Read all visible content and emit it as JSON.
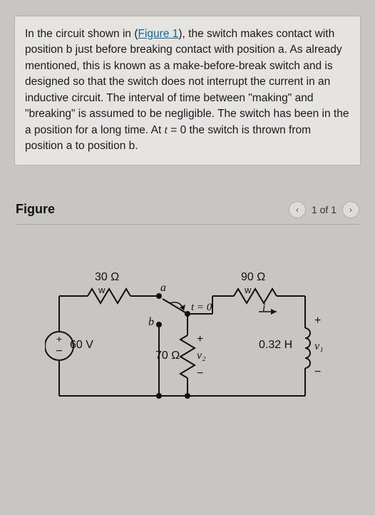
{
  "problem": {
    "text_before_link": "In the circuit shown in (",
    "link_label": "Figure 1",
    "text_after_link": "), the switch makes contact with position b just before breaking contact with position a. As already mentioned, this is known as a make-before-break switch and is designed so that the switch does not interrupt the current in an inductive circuit. The interval of time between \"making\" and \"breaking\" is assumed to be negligible. The switch has been in the a position for a long time. At ",
    "time_var": "t",
    "equals": " = 0 the switch is thrown from position a to position b."
  },
  "figure": {
    "title": "Figure",
    "pager": "1 of 1"
  },
  "circuit": {
    "r1": "30 Ω",
    "r2": "70 Ω",
    "r3": "90 Ω",
    "L": "0.32 H",
    "V": "60 V",
    "pos_a": "a",
    "pos_b": "b",
    "time0": "t = 0",
    "i": "i",
    "v1": "v₁",
    "v2": "v₂",
    "plus": "+",
    "minus": "−"
  }
}
